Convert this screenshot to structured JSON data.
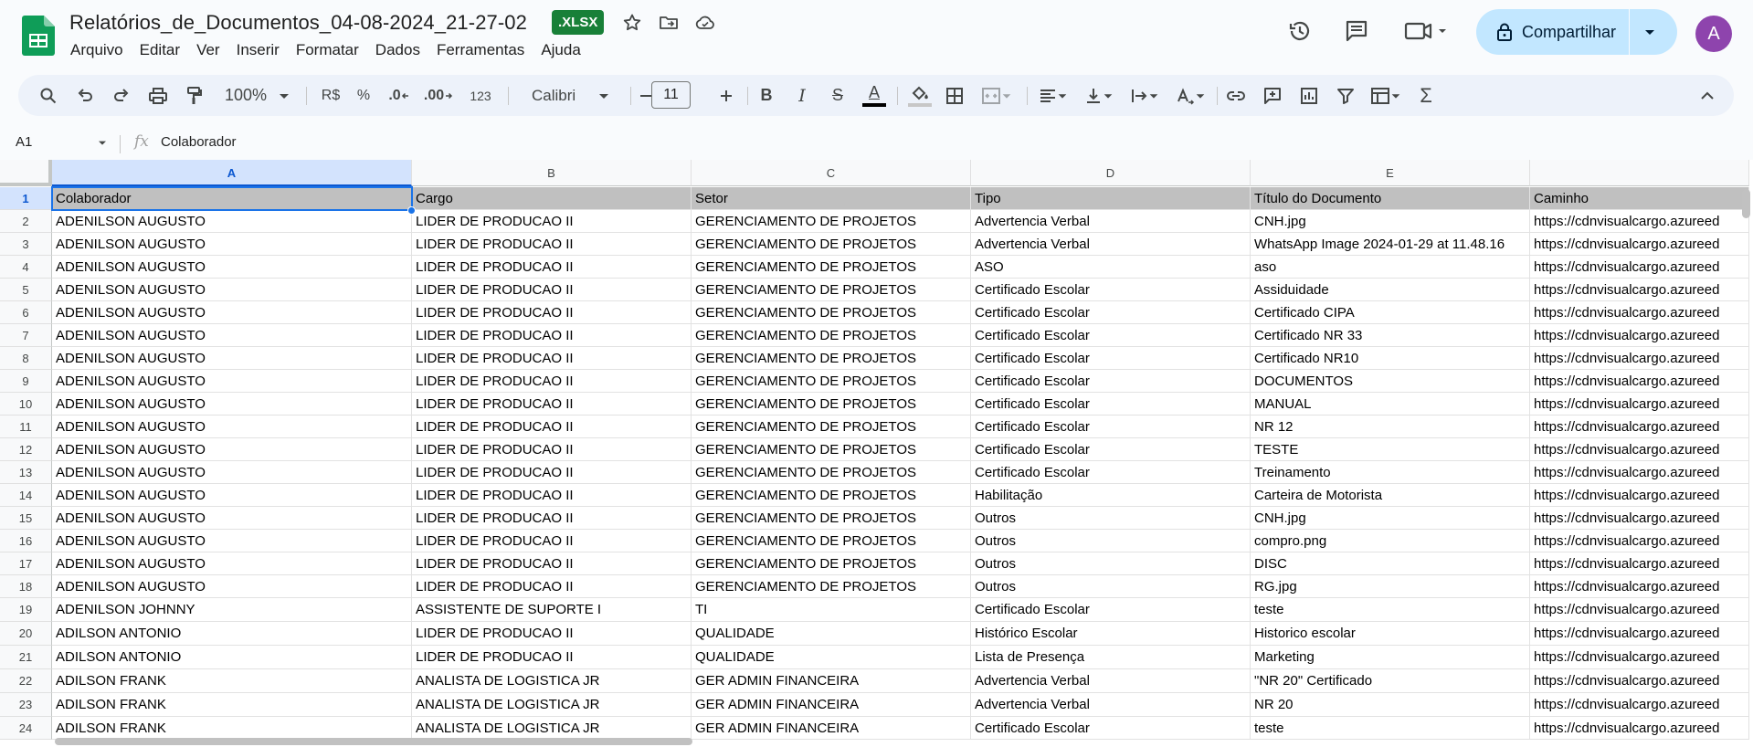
{
  "doc": {
    "title": "Relatórios_de_Documentos_04-08-2024_21-27-02",
    "badge": ".XLSX",
    "menu": [
      "Arquivo",
      "Editar",
      "Ver",
      "Inserir",
      "Formatar",
      "Dados",
      "Ferramentas",
      "Ajuda"
    ],
    "share_label": "Compartilhar",
    "avatar_letter": "A"
  },
  "toolbar": {
    "zoom": "100%",
    "currency": "R$",
    "percent": "%",
    "dec_decrease": ".0",
    "dec_increase": ".00",
    "number_format": "123",
    "font": "Calibri",
    "font_size": "11",
    "bold": "B",
    "italic": "I",
    "strike": "S",
    "text_color_letter": "A",
    "text_color": "#000000",
    "sigma": "Σ"
  },
  "formula": {
    "cell_ref": "A1",
    "fx": "fx",
    "content": "Colaborador"
  },
  "colors": {
    "accent": "#1a73e8",
    "header_fill": "#c0c0c0",
    "selected_header": "#d3e3fd",
    "share_bg": "#c2e7ff",
    "badge_green": "#188038"
  },
  "grid": {
    "columns": [
      "A",
      "B",
      "C",
      "D",
      "E"
    ],
    "rows": [
      {
        "n": "1",
        "cells": [
          "Colaborador",
          "Cargo",
          "Setor",
          "Tipo",
          "Título do Documento",
          "Caminho"
        ]
      },
      {
        "n": "2",
        "cells": [
          "ADENILSON AUGUSTO",
          "LIDER DE PRODUCAO II",
          "GERENCIAMENTO DE PROJETOS",
          "Advertencia Verbal",
          "CNH.jpg",
          "https://cdnvisualcargo.azureed"
        ]
      },
      {
        "n": "3",
        "cells": [
          "ADENILSON AUGUSTO",
          "LIDER DE PRODUCAO II",
          "GERENCIAMENTO DE PROJETOS",
          "Advertencia Verbal",
          "WhatsApp Image 2024-01-29 at 11.48.16",
          "https://cdnvisualcargo.azureed"
        ]
      },
      {
        "n": "4",
        "cells": [
          "ADENILSON AUGUSTO",
          "LIDER DE PRODUCAO II",
          "GERENCIAMENTO DE PROJETOS",
          "ASO",
          "aso",
          "https://cdnvisualcargo.azureed"
        ]
      },
      {
        "n": "5",
        "cells": [
          "ADENILSON AUGUSTO",
          "LIDER DE PRODUCAO II",
          "GERENCIAMENTO DE PROJETOS",
          "Certificado Escolar",
          "Assiduidade",
          "https://cdnvisualcargo.azureed"
        ]
      },
      {
        "n": "6",
        "cells": [
          "ADENILSON AUGUSTO",
          "LIDER DE PRODUCAO II",
          "GERENCIAMENTO DE PROJETOS",
          "Certificado Escolar",
          "Certificado CIPA",
          "https://cdnvisualcargo.azureed"
        ]
      },
      {
        "n": "7",
        "cells": [
          "ADENILSON AUGUSTO",
          "LIDER DE PRODUCAO II",
          "GERENCIAMENTO DE PROJETOS",
          "Certificado Escolar",
          "Certificado NR 33",
          "https://cdnvisualcargo.azureed"
        ]
      },
      {
        "n": "8",
        "cells": [
          "ADENILSON AUGUSTO",
          "LIDER DE PRODUCAO II",
          "GERENCIAMENTO DE PROJETOS",
          "Certificado Escolar",
          "Certificado NR10",
          "https://cdnvisualcargo.azureed"
        ]
      },
      {
        "n": "9",
        "cells": [
          "ADENILSON AUGUSTO",
          "LIDER DE PRODUCAO II",
          "GERENCIAMENTO DE PROJETOS",
          "Certificado Escolar",
          "DOCUMENTOS",
          "https://cdnvisualcargo.azureed"
        ]
      },
      {
        "n": "10",
        "cells": [
          "ADENILSON AUGUSTO",
          "LIDER DE PRODUCAO II",
          "GERENCIAMENTO DE PROJETOS",
          "Certificado Escolar",
          "MANUAL",
          "https://cdnvisualcargo.azureed"
        ]
      },
      {
        "n": "11",
        "cells": [
          "ADENILSON AUGUSTO",
          "LIDER DE PRODUCAO II",
          "GERENCIAMENTO DE PROJETOS",
          "Certificado Escolar",
          "NR 12",
          "https://cdnvisualcargo.azureed"
        ]
      },
      {
        "n": "12",
        "cells": [
          "ADENILSON AUGUSTO",
          "LIDER DE PRODUCAO II",
          "GERENCIAMENTO DE PROJETOS",
          "Certificado Escolar",
          "TESTE",
          "https://cdnvisualcargo.azureed"
        ]
      },
      {
        "n": "13",
        "cells": [
          "ADENILSON AUGUSTO",
          "LIDER DE PRODUCAO II",
          "GERENCIAMENTO DE PROJETOS",
          "Certificado Escolar",
          "Treinamento",
          "https://cdnvisualcargo.azureed"
        ]
      },
      {
        "n": "14",
        "cells": [
          "ADENILSON AUGUSTO",
          "LIDER DE PRODUCAO II",
          "GERENCIAMENTO DE PROJETOS",
          "Habilitação",
          "Carteira de Motorista",
          "https://cdnvisualcargo.azureed"
        ]
      },
      {
        "n": "15",
        "cells": [
          "ADENILSON AUGUSTO",
          "LIDER DE PRODUCAO II",
          "GERENCIAMENTO DE PROJETOS",
          "Outros",
          "CNH.jpg",
          "https://cdnvisualcargo.azureed"
        ]
      },
      {
        "n": "16",
        "cells": [
          "ADENILSON AUGUSTO",
          "LIDER DE PRODUCAO II",
          "GERENCIAMENTO DE PROJETOS",
          "Outros",
          "compro.png",
          "https://cdnvisualcargo.azureed"
        ]
      },
      {
        "n": "17",
        "cells": [
          "ADENILSON AUGUSTO",
          "LIDER DE PRODUCAO II",
          "GERENCIAMENTO DE PROJETOS",
          "Outros",
          "DISC",
          "https://cdnvisualcargo.azureed"
        ]
      },
      {
        "n": "18",
        "cells": [
          "ADENILSON AUGUSTO",
          "LIDER DE PRODUCAO II",
          "GERENCIAMENTO DE PROJETOS",
          "Outros",
          "RG.jpg",
          "https://cdnvisualcargo.azureed"
        ]
      },
      {
        "n": "19",
        "cells": [
          "ADENILSON JOHNNY",
          "ASSISTENTE DE SUPORTE I",
          "TI",
          "Certificado Escolar",
          "teste",
          "https://cdnvisualcargo.azureed"
        ]
      },
      {
        "n": "20",
        "cells": [
          "ADILSON ANTONIO",
          "LIDER DE PRODUCAO II",
          "QUALIDADE",
          "Histórico Escolar",
          "Historico escolar",
          "https://cdnvisualcargo.azureed"
        ]
      },
      {
        "n": "21",
        "cells": [
          "ADILSON ANTONIO",
          "LIDER DE PRODUCAO II",
          "QUALIDADE",
          "Lista de Presença",
          "Marketing",
          "https://cdnvisualcargo.azureed"
        ]
      },
      {
        "n": "22",
        "cells": [
          "ADILSON FRANK",
          "ANALISTA DE LOGISTICA JR",
          "GER ADMIN FINANCEIRA",
          "Advertencia Verbal",
          "\"NR 20\" Certificado",
          "https://cdnvisualcargo.azureed"
        ]
      },
      {
        "n": "23",
        "cells": [
          "ADILSON FRANK",
          "ANALISTA DE LOGISTICA JR",
          "GER ADMIN FINANCEIRA",
          "Advertencia Verbal",
          "NR 20",
          "https://cdnvisualcargo.azureed"
        ]
      },
      {
        "n": "24",
        "cells": [
          "ADILSON FRANK",
          "ANALISTA DE LOGISTICA JR",
          "GER ADMIN FINANCEIRA",
          "Certificado Escolar",
          "teste",
          "https://cdnvisualcargo.azureed"
        ]
      }
    ]
  }
}
